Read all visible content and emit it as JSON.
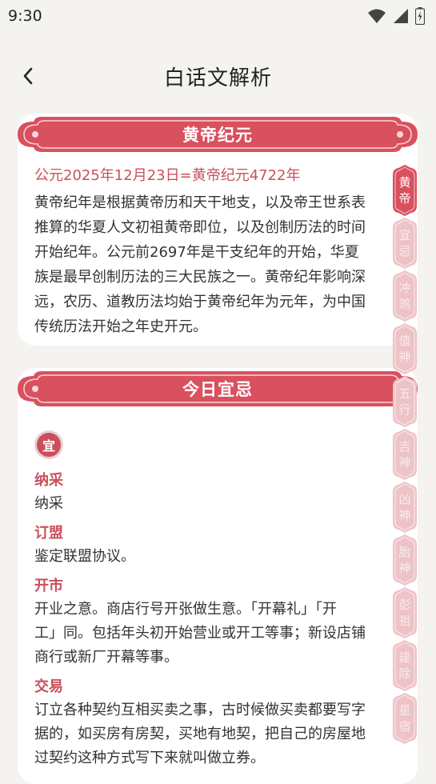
{
  "status": {
    "time": "9:30"
  },
  "header": {
    "title": "白话文解析"
  },
  "section1": {
    "title": "黄帝纪元",
    "highlight": "公元2025年12月23日=黄帝纪元4722年",
    "lines": [
      "黄帝纪年是根据黄帝历和天干地支，以及帝王世系表",
      "推算的华夏人文初祖黄帝即位，以及创制历法的时间",
      "开始纪年。公元前2697年是干支纪年的开始，华夏",
      "族是最早创制历法的三大民族之一。黄帝纪年影响深",
      "远，农历、道教历法均始于黄帝纪年为元年，为中国",
      "传统历法开始之年史开元。"
    ]
  },
  "section2": {
    "title": "今日宜忌",
    "badge": "宜",
    "entries": [
      {
        "title": "纳采",
        "lines": [
          "纳采"
        ]
      },
      {
        "title": "订盟",
        "lines": [
          "鉴定联盟协议。"
        ]
      },
      {
        "title": "开市",
        "lines": [
          "开业之意。商店行号开张做生意。「开幕礼」「开",
          "工」同。包括年头初开始营业或开工等事；新设店铺",
          "商行或新厂开幕等事。"
        ]
      },
      {
        "title": "交易",
        "lines": [
          "订立各种契约互相买卖之事，古时候做买卖都要写字",
          "据的，如买房有房契，买地有地契，把自己的房屋地",
          "过契约这种方式写下来就叫做立券。"
        ]
      }
    ]
  },
  "sidetabs": [
    {
      "label": "黄帝",
      "active": true
    },
    {
      "label": "宜忌",
      "active": false
    },
    {
      "label": "冲煞",
      "active": false
    },
    {
      "label": "值神",
      "active": false
    },
    {
      "label": "五行",
      "active": false
    },
    {
      "label": "吉神",
      "active": false
    },
    {
      "label": "凶神",
      "active": false
    },
    {
      "label": "胎神",
      "active": false
    },
    {
      "label": "彭祖",
      "active": false
    },
    {
      "label": "建除",
      "active": false
    },
    {
      "label": "星宿",
      "active": false
    }
  ],
  "colors": {
    "accent": "#d9505e",
    "accent_dark": "#b8404d",
    "tab_inactive": "#edc3c7",
    "background": "#f5f3ef"
  }
}
